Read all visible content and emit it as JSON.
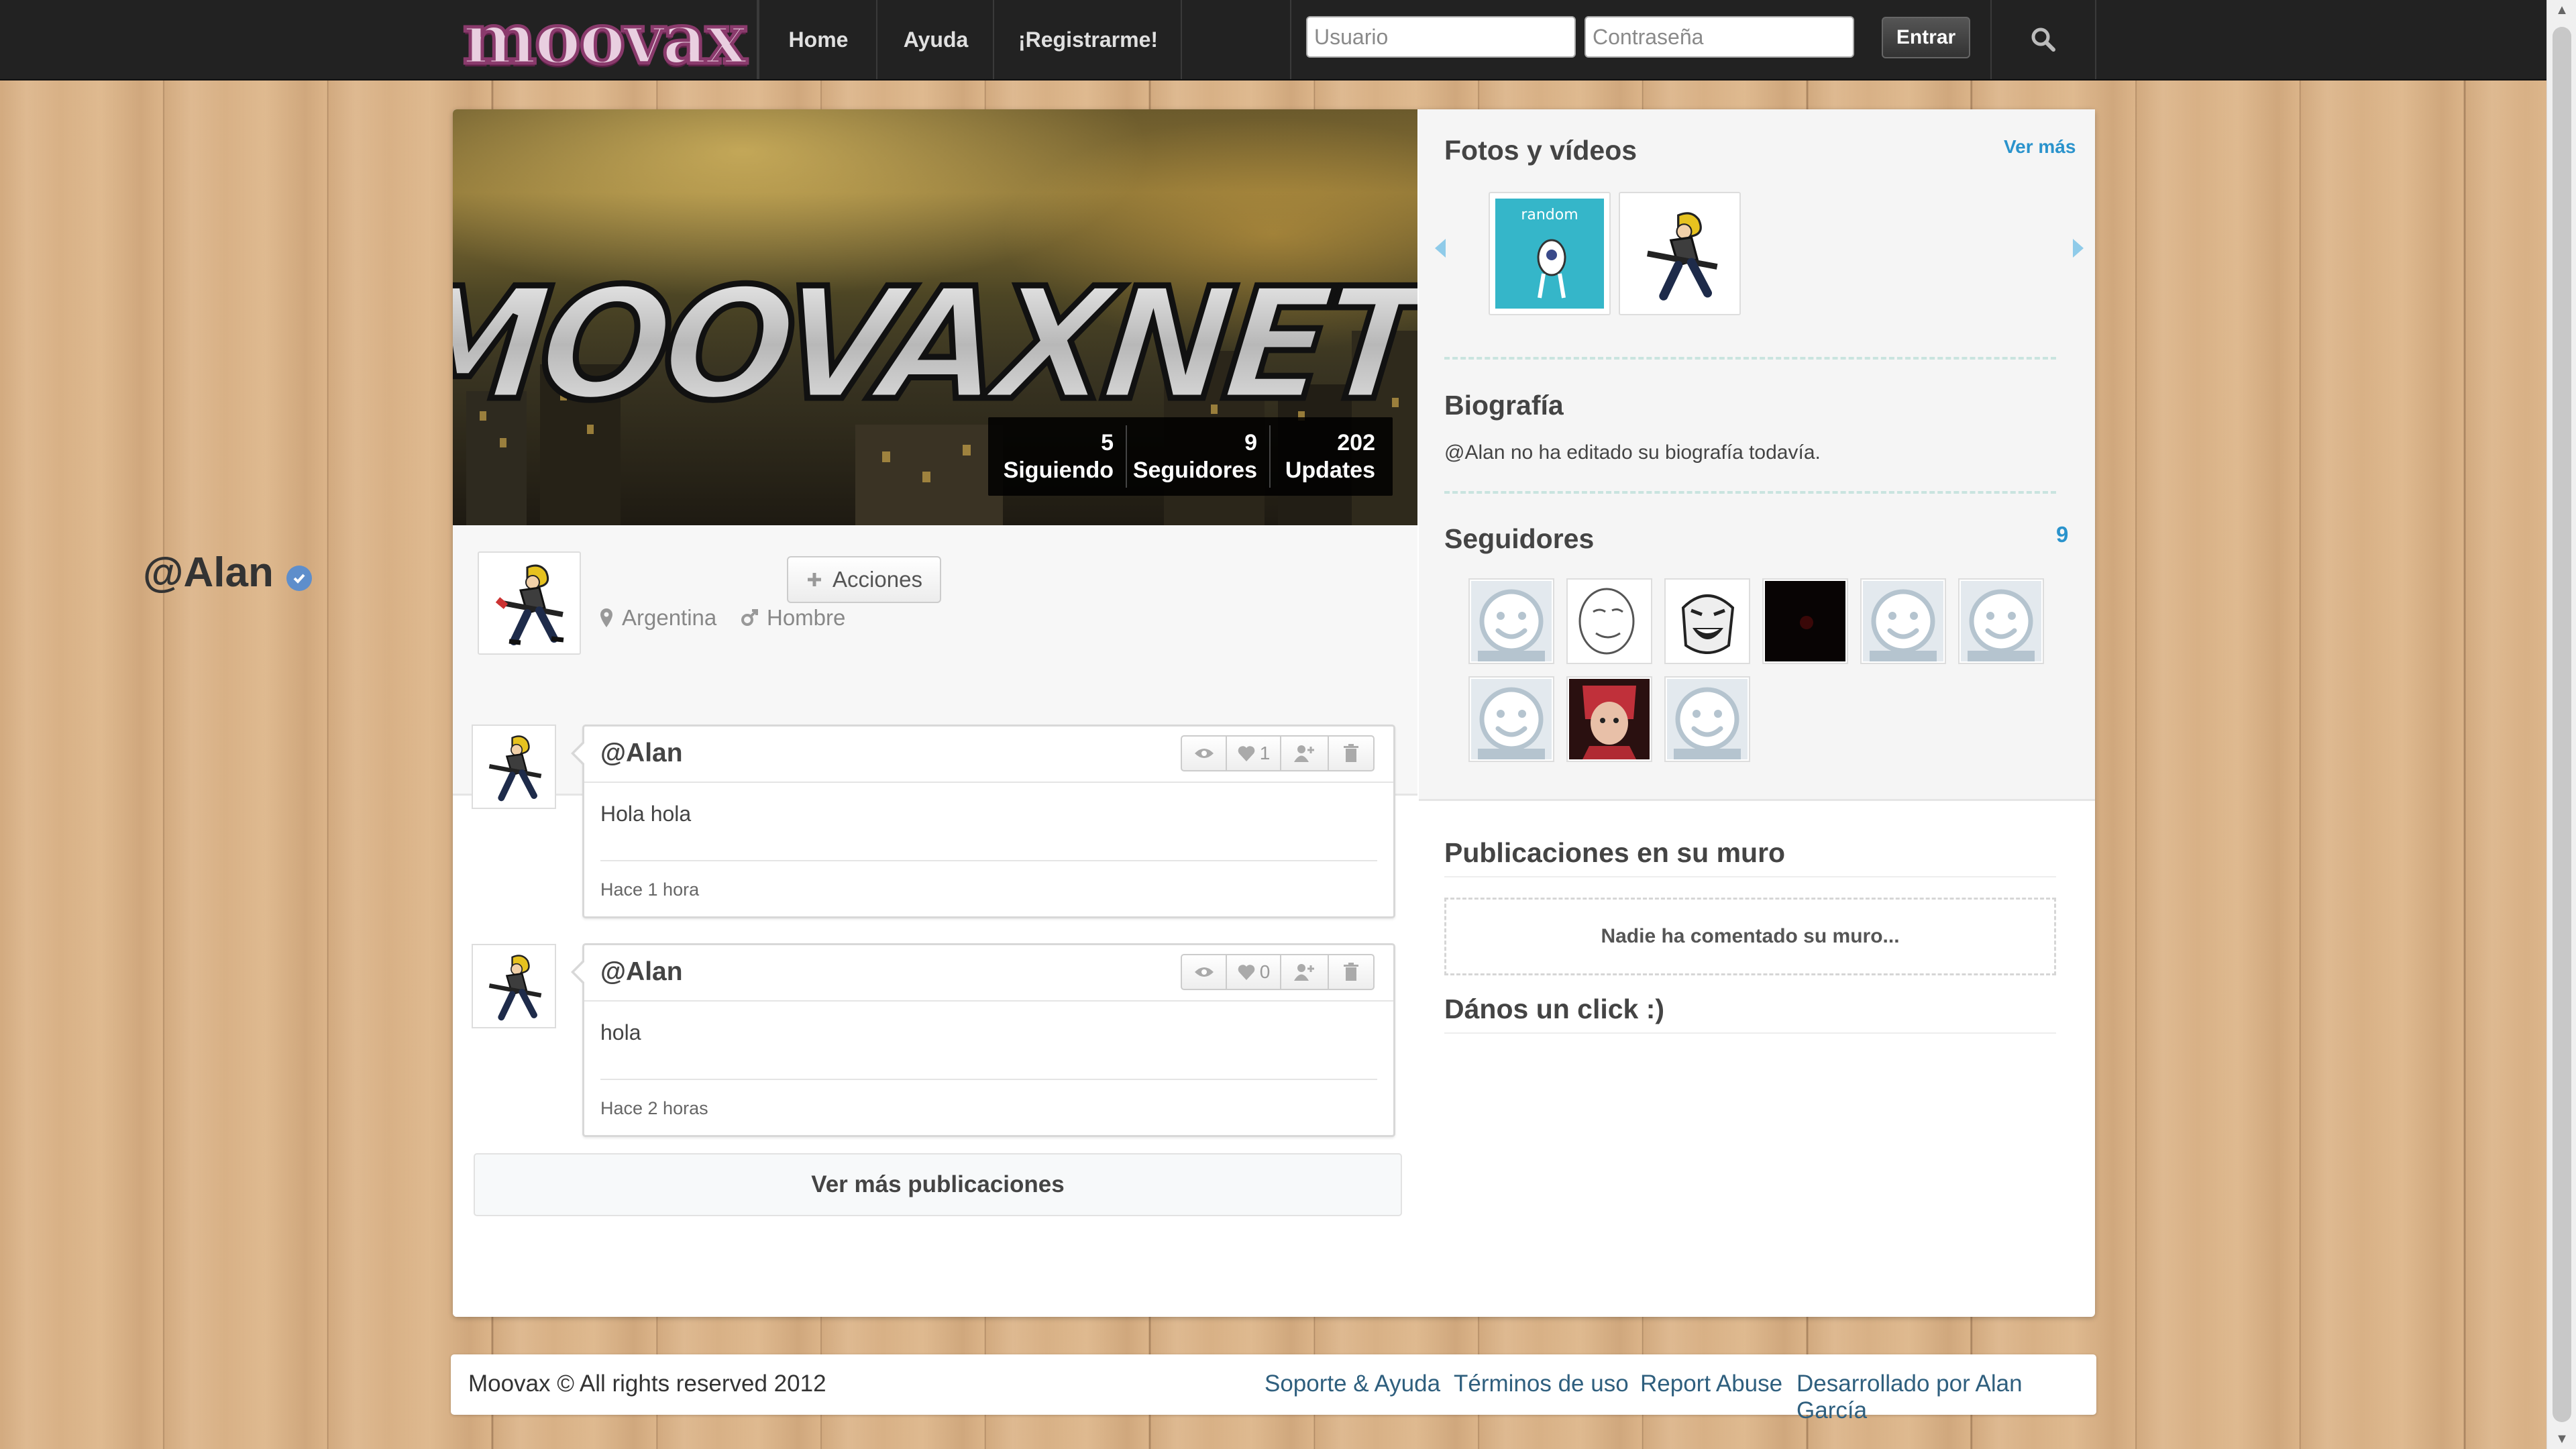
{
  "header": {
    "logo_text": "moovax",
    "nav": [
      "Home",
      "Ayuda",
      "¡Registrarme!"
    ],
    "username_placeholder": "Usuario",
    "password_placeholder": "Contraseña",
    "login_button": "Entrar"
  },
  "banner": {
    "art_text": "MOOVAXNET",
    "stats": [
      {
        "value": "5",
        "label": "Siguiendo"
      },
      {
        "value": "9",
        "label": "Seguidores"
      },
      {
        "value": "202",
        "label": "Updates"
      }
    ]
  },
  "profile": {
    "username": "@Alan",
    "location": "Argentina",
    "gender": "Hombre",
    "actions_label": "Acciones"
  },
  "posts": [
    {
      "user": "@Alan",
      "likes": "1",
      "text": "Hola hola",
      "time": "Hace 1 hora"
    },
    {
      "user": "@Alan",
      "likes": "0",
      "text": "hola",
      "time": "Hace 2 horas"
    }
  ],
  "more_posts_label": "Ver más publicaciones",
  "sidebar": {
    "media_title": "Fotos y vídeos",
    "media_more": "Ver más",
    "media_thumb1_text": "random",
    "bio_title": "Biografía",
    "bio_text": "@Alan no ha editado su biografía todavía.",
    "followers_title": "Seguidores",
    "followers_count": "9",
    "wall_title": "Publicaciones en su muro",
    "wall_empty": "Nadie ha comentado su muro...",
    "click_title": "Dános un click :)"
  },
  "footer": {
    "copyright": "Moovax © All rights reserved 2012",
    "links": [
      "Soporte & Ayuda",
      "Términos de uso",
      "Report Abuse",
      "Desarrollado por Alan García"
    ]
  },
  "colors": {
    "topbar": "#222222",
    "link_blue": "#2a93cc",
    "verified_badge": "#5e8ecb",
    "wood": "#dcb58a"
  }
}
